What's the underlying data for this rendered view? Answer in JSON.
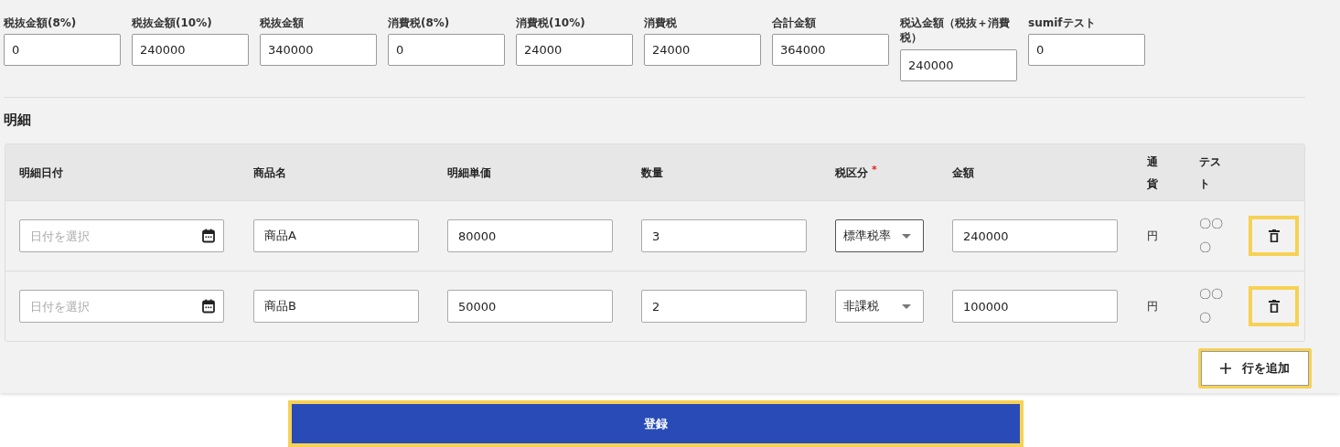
{
  "summary_fields": [
    {
      "label": "税抜金額(8%)",
      "value": "0"
    },
    {
      "label": "税抜金額(10%)",
      "value": "240000"
    },
    {
      "label": "税抜金額",
      "value": "340000"
    },
    {
      "label": "消費税(8%)",
      "value": "0"
    },
    {
      "label": "消費税(10%)",
      "value": "24000"
    },
    {
      "label": "消費税",
      "value": "24000"
    },
    {
      "label": "合計金額",
      "value": "364000"
    },
    {
      "label": "税込金額（税抜＋消費税）",
      "value": "240000"
    },
    {
      "label": "sumifテスト",
      "value": "0"
    }
  ],
  "section_title": "明細",
  "table": {
    "columns": [
      {
        "label": "明細日付"
      },
      {
        "label": "商品名"
      },
      {
        "label": "明細単価"
      },
      {
        "label": "数量"
      },
      {
        "label": "税区分",
        "required_mark": "*"
      },
      {
        "label": "金額"
      },
      {
        "label": "通貨"
      },
      {
        "label": "テスト"
      }
    ],
    "rows": [
      {
        "date_placeholder": "日付を選択",
        "product": "商品A",
        "unit_price": "80000",
        "quantity": "3",
        "tax_type": "標準税率",
        "tax_focused": true,
        "amount": "240000",
        "currency": "円",
        "test": "〇〇〇"
      },
      {
        "date_placeholder": "日付を選択",
        "product": "商品B",
        "unit_price": "50000",
        "quantity": "2",
        "tax_type": "非課税",
        "tax_focused": false,
        "amount": "100000",
        "currency": "円",
        "test": "〇〇〇"
      }
    ]
  },
  "add_row_button": {
    "label": "行を追加"
  },
  "submit_button": {
    "label": "登録"
  }
}
